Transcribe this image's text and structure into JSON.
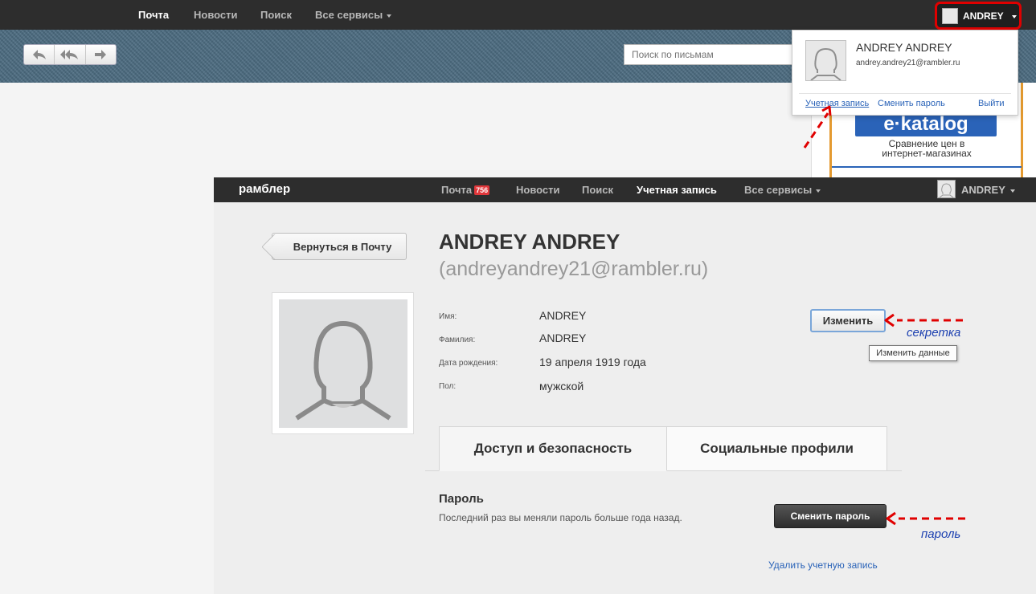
{
  "mail_nav": {
    "items": [
      "Почта",
      "Новости",
      "Поиск",
      "Все сервисы"
    ],
    "user": "ANDREY"
  },
  "mail_search": {
    "placeholder": "Поиск по письмам"
  },
  "dropdown": {
    "name": "ANDREY ANDREY",
    "email": "andrey.andrey21@rambler.ru",
    "links": [
      "Учетная запись",
      "Сменить пароль",
      "Выйти"
    ]
  },
  "ad": {
    "logo": "e·katalog",
    "line1": "Сравнение цен в",
    "line2": "интернет-магазинах"
  },
  "account_nav": {
    "brand": "рамблер",
    "items": [
      "Почта",
      "Новости",
      "Поиск",
      "Учетная запись",
      "Все сервисы"
    ],
    "mail_badge": "756",
    "user": "ANDREY"
  },
  "account": {
    "back_label": "Вернуться в Почту",
    "full_name": "ANDREY ANDREY",
    "email": "(andreyandrey21@rambler.ru)",
    "fields": [
      {
        "label": "Имя:",
        "value": "ANDREY"
      },
      {
        "label": "Фамилия:",
        "value": "ANDREY"
      },
      {
        "label": "Дата рождения:",
        "value": "19 апреля 1919 года"
      },
      {
        "label": "Пол:",
        "value": "мужской"
      }
    ],
    "edit_label": "Изменить",
    "edit_tooltip": "Изменить данные",
    "tabs": [
      "Доступ и безопасность",
      "Социальные профили"
    ],
    "password_title": "Пароль",
    "password_desc": "Последний раз вы меняли пароль больше года назад.",
    "change_password_label": "Сменить пароль",
    "delete_link": "Удалить учетную запись"
  },
  "annotations": {
    "secret": "секретка",
    "password": "пароль"
  },
  "colors": {
    "nav_bg": "#2d2d2d",
    "link": "#2a63b8",
    "annotation": "#1b3fb0",
    "highlight": "#e00000",
    "badge": "#e0373b"
  }
}
